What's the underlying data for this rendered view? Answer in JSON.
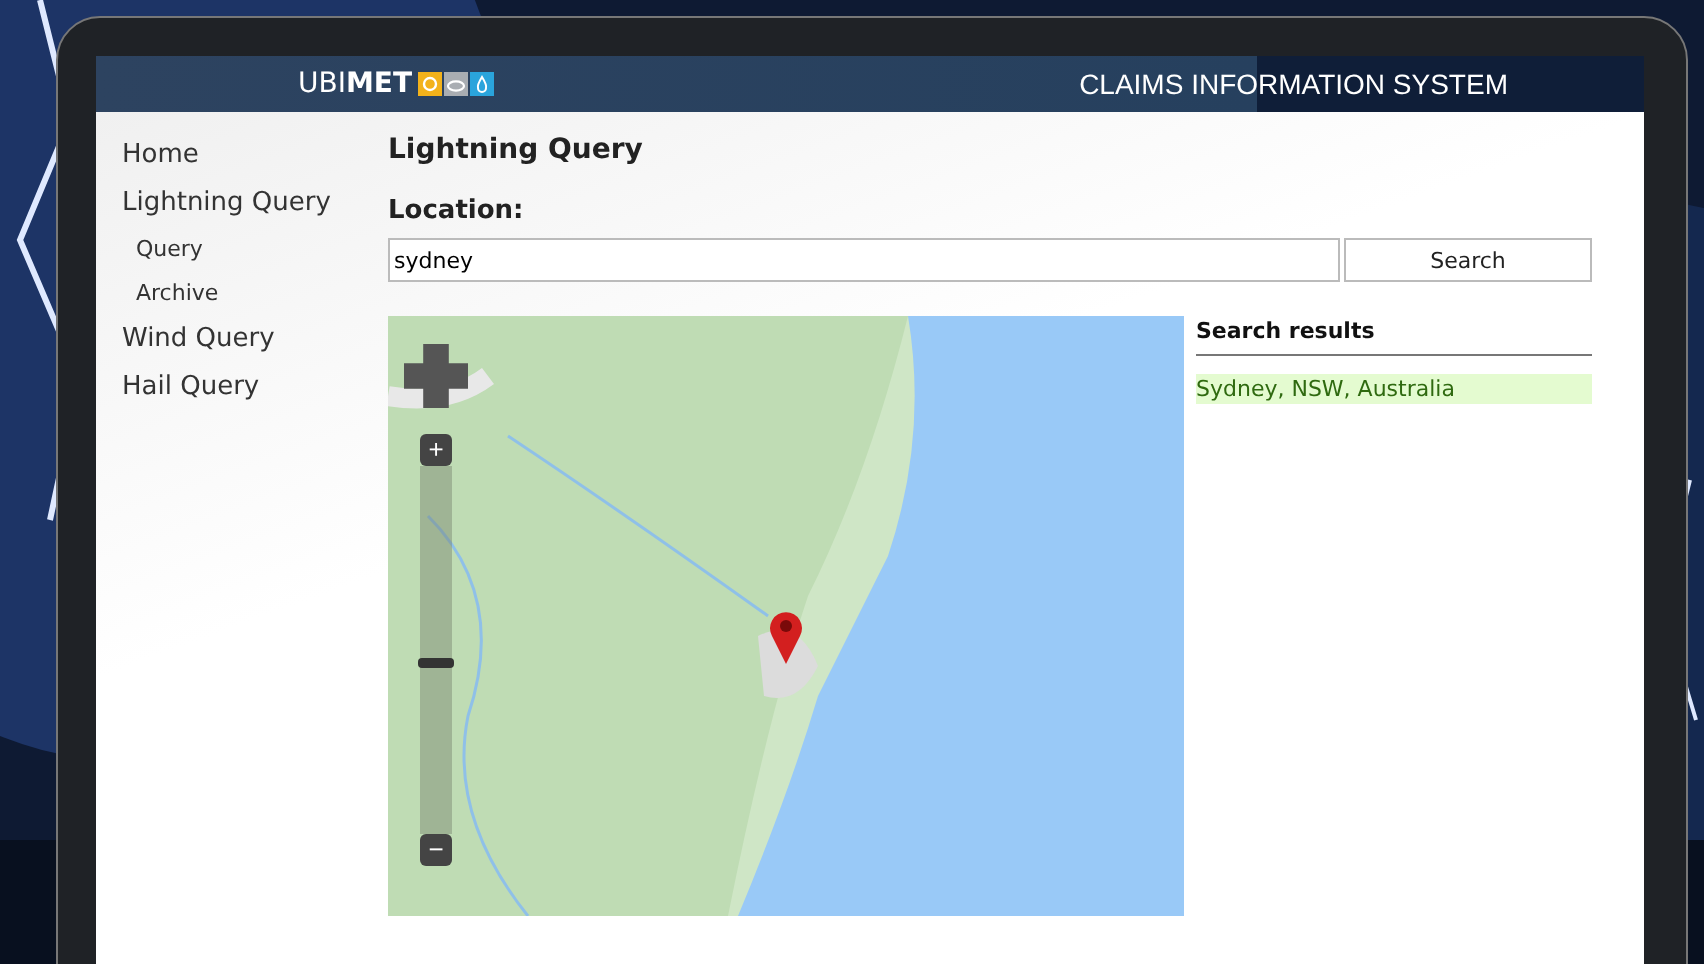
{
  "header": {
    "logo": "UBI**MET**",
    "title": "CLAIMS INFORMATION SYSTEM"
  },
  "sidebar": {
    "items": [
      {
        "label": "Home"
      },
      {
        "label": "Lightning Query",
        "children": [
          {
            "label": "Query"
          },
          {
            "label": "Archive"
          }
        ]
      },
      {
        "label": "Wind Query"
      },
      {
        "label": "Hail Query"
      }
    ]
  },
  "page_title": "Lightning Query",
  "location": {
    "label": "Location:",
    "value": "sydney",
    "button": "Search"
  },
  "map": {
    "zoom_in": "+",
    "zoom_out": "−",
    "zoom": {
      "level": 0.47
    }
  },
  "results": {
    "title": "Search results",
    "items": [
      {
        "label": "Sydney, NSW, Australia",
        "selected": true
      }
    ]
  }
}
